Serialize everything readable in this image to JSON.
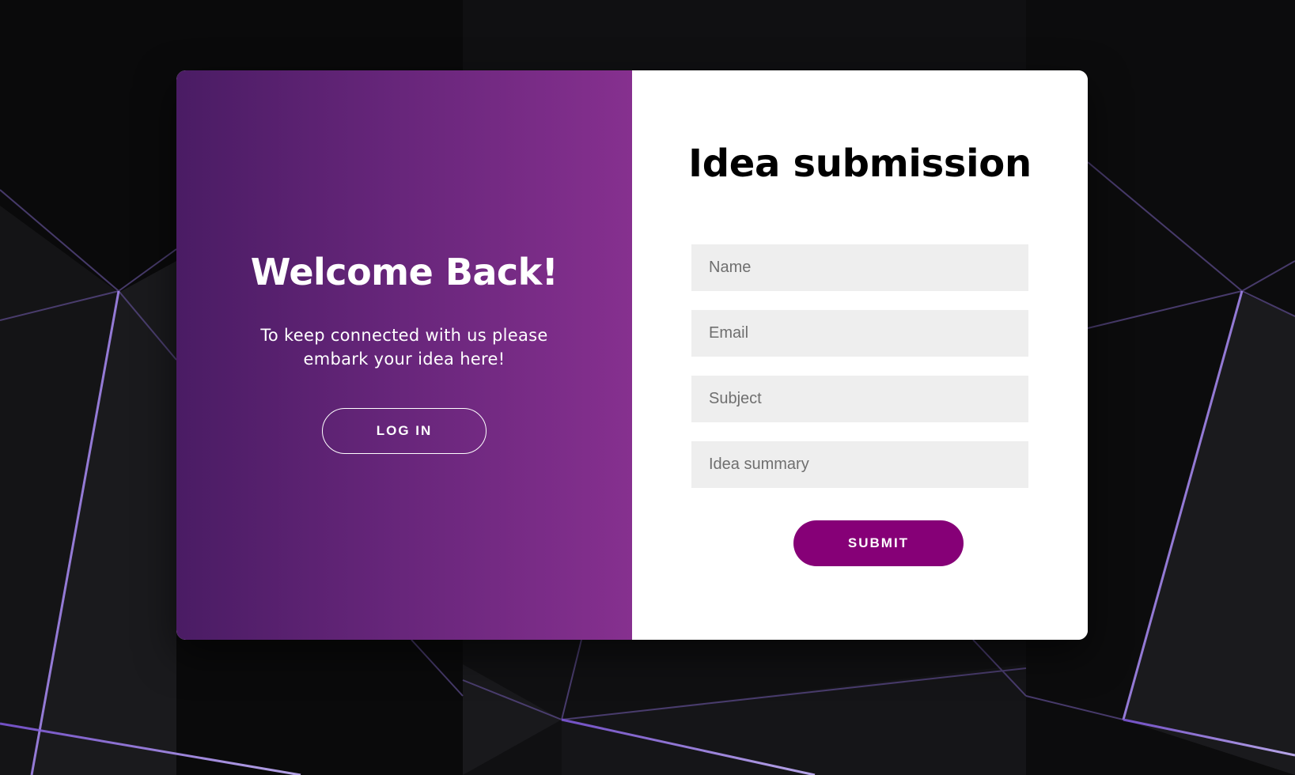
{
  "colors": {
    "left_panel_gradient_start": "#4a1c64",
    "left_panel_gradient_end": "#86308f",
    "submit_button": "#860077",
    "input_background": "#eeeeee",
    "background": "#0b0b0d",
    "background_accent": "#9a6cff"
  },
  "left_panel": {
    "heading": "Welcome Back!",
    "message": "To keep connected with us please embark your idea here!",
    "login_label": "LOG IN"
  },
  "form": {
    "title": "Idea submission",
    "name_placeholder": "Name",
    "email_placeholder": "Email",
    "subject_placeholder": "Subject",
    "summary_placeholder": "Idea summary",
    "submit_label": "SUBMIT"
  }
}
